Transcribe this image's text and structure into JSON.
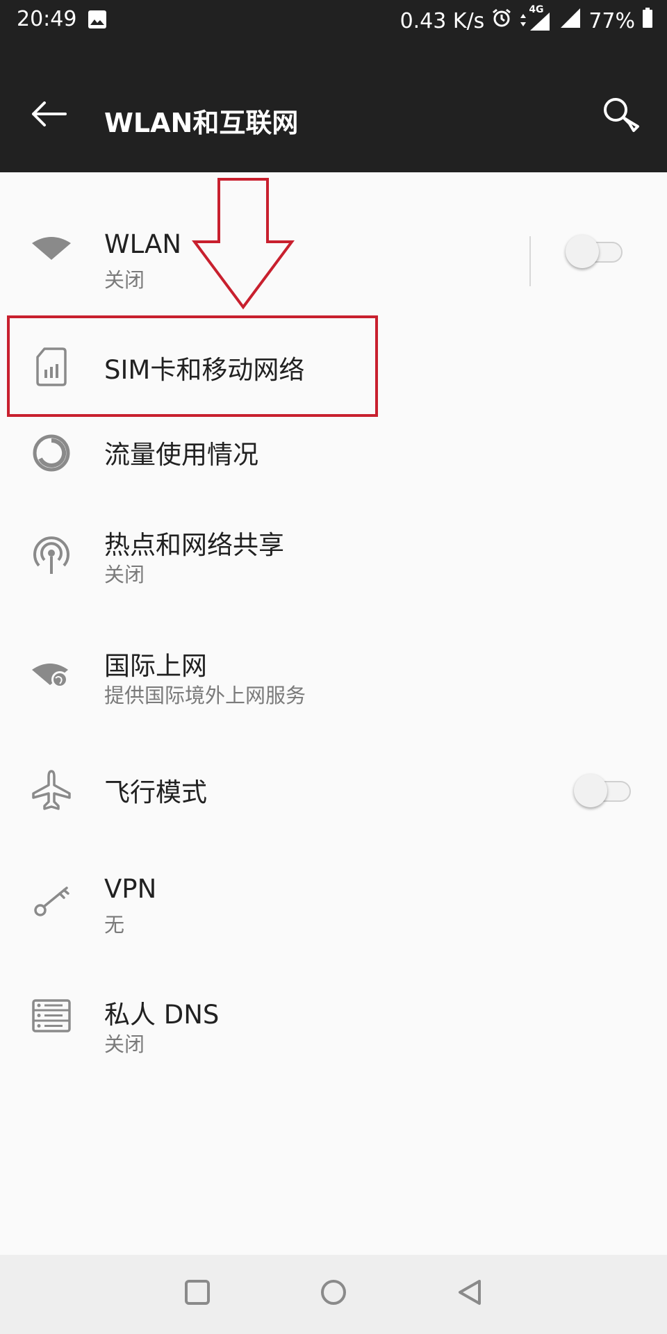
{
  "status_bar": {
    "time": "20:49",
    "net_speed": "0.43 K/s",
    "network_type": "4G",
    "battery": "77%"
  },
  "app_bar": {
    "title": "WLAN和互联网"
  },
  "items": [
    {
      "label": "WLAN",
      "sub": "关闭",
      "icon": "wifi-icon",
      "toggle": "off"
    },
    {
      "label": "SIM卡和移动网络",
      "icon": "sim-card-icon"
    },
    {
      "label": "流量使用情况",
      "icon": "data-usage-icon"
    },
    {
      "label": "热点和网络共享",
      "sub": "关闭",
      "icon": "hotspot-icon"
    },
    {
      "label": "国际上网",
      "sub": "提供国际境外上网服务",
      "icon": "international-roaming-icon"
    },
    {
      "label": "飞行模式",
      "icon": "airplane-icon",
      "toggle": "off"
    },
    {
      "label": "VPN",
      "sub": "无",
      "icon": "key-icon"
    },
    {
      "label": "私人 DNS",
      "sub": "关闭",
      "icon": "dns-server-icon"
    }
  ],
  "colors": {
    "bar_bg": "#212121",
    "page_bg": "#fafafa",
    "annotation": "#c8202e",
    "nav_bg": "#eeeeee"
  }
}
